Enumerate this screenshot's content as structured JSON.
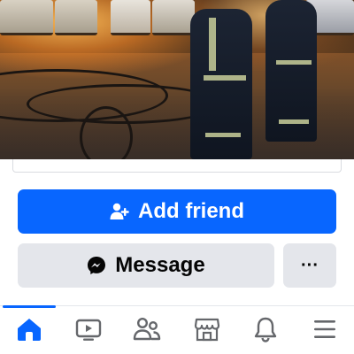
{
  "cover_photo": {
    "alt_icon": "cover-photo"
  },
  "actions": {
    "add_friend_label": "Add friend",
    "add_friend_icon": "add-person-icon",
    "message_label": "Message",
    "message_icon": "messenger-icon",
    "more_label": "···",
    "accent_color": "#0866ff",
    "secondary_bg": "#e4e6eb"
  },
  "tabbar": {
    "active_tab": "home",
    "tabs": [
      {
        "name": "home",
        "icon": "home-icon"
      },
      {
        "name": "video",
        "icon": "video-icon"
      },
      {
        "name": "friends",
        "icon": "friends-icon"
      },
      {
        "name": "marketplace",
        "icon": "marketplace-icon"
      },
      {
        "name": "notifications",
        "icon": "bell-icon"
      },
      {
        "name": "menu",
        "icon": "menu-icon"
      }
    ]
  }
}
